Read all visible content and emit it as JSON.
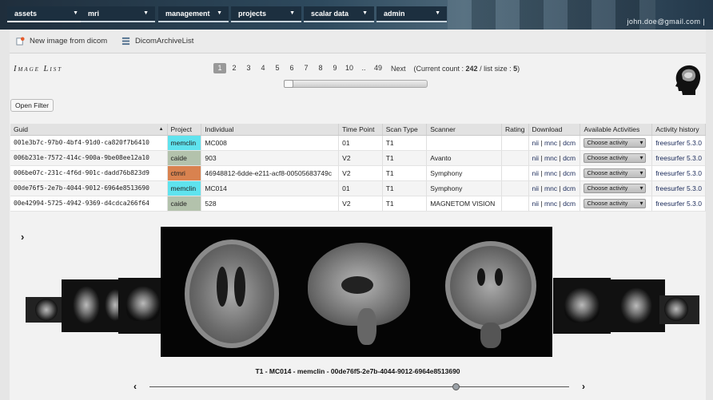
{
  "nav": {
    "menus": [
      {
        "label": "assets",
        "active": true
      },
      {
        "label": "mri"
      },
      {
        "label": "management"
      },
      {
        "label": "projects"
      },
      {
        "label": "scalar data"
      },
      {
        "label": "admin"
      }
    ],
    "user_email": "john.doe@gmail.com |"
  },
  "toolbar": {
    "new_image_label": "New image from dicom",
    "dicom_archive_label": "DicomArchiveList"
  },
  "list": {
    "title": "Image List",
    "open_filter_label": "Open Filter"
  },
  "pager": {
    "pages": [
      "1",
      "2",
      "3",
      "4",
      "5",
      "6",
      "7",
      "8",
      "9",
      "10",
      "..",
      "49"
    ],
    "current": "1",
    "next_label": "Next",
    "count_prefix": "(Current count : ",
    "count_value": "242",
    "count_mid": " / list size : ",
    "size_value": "5",
    "count_suffix": ")"
  },
  "table": {
    "columns": [
      "Guid",
      "Project",
      "Individual",
      "Time Point",
      "Scan Type",
      "Scanner",
      "Rating",
      "Download",
      "Available Activities",
      "Activity history"
    ],
    "rows": [
      {
        "guid": "001e3b7c-97b0-4bf4-91d0-ca820f7b6410",
        "project": "memclin",
        "project_color": "#5fe3ee",
        "individual": "MC008",
        "timepoint": "01",
        "scantype": "T1",
        "scanner": "",
        "rating": "",
        "dl_nii": "nii",
        "dl_mnc": "mnc",
        "dl_dcm": "dcm",
        "activity": "Choose activity",
        "history": "freesurfer 5.3.0"
      },
      {
        "guid": "006b231e-7572-414c-900a-9be08ee12a10",
        "project": "caide",
        "project_color": "#b3c2ac",
        "individual": "903",
        "timepoint": "V2",
        "scantype": "T1",
        "scanner": "Avanto",
        "rating": "",
        "dl_nii": "nii",
        "dl_mnc": "mnc",
        "dl_dcm": "dcm",
        "activity": "Choose activity",
        "history": "freesurfer 5.3.0"
      },
      {
        "guid": "006be07c-231c-4f6d-901c-dadd76b823d9",
        "project": "ctmri",
        "project_color": "#d9824f",
        "individual": "46948812-6dde-e211-acf8-00505683749c",
        "timepoint": "V2",
        "scantype": "T1",
        "scanner": "Symphony",
        "rating": "",
        "dl_nii": "nii",
        "dl_mnc": "mnc",
        "dl_dcm": "dcm",
        "activity": "Choose activity",
        "history": "freesurfer 5.3.0"
      },
      {
        "guid": "00de76f5-2e7b-4044-9012-6964e8513690",
        "project": "memclin",
        "project_color": "#5fe3ee",
        "individual": "MC014",
        "timepoint": "01",
        "scantype": "T1",
        "scanner": "Symphony",
        "rating": "",
        "dl_nii": "nii",
        "dl_mnc": "mnc",
        "dl_dcm": "dcm",
        "activity": "Choose activity",
        "history": "freesurfer 5.3.0"
      },
      {
        "guid": "00e42994-5725-4942-9369-d4cdca266f64",
        "project": "caide",
        "project_color": "#b3c2ac",
        "individual": "528",
        "timepoint": "V2",
        "scantype": "T1",
        "scanner": "MAGNETOM VISION",
        "rating": "",
        "dl_nii": "nii",
        "dl_mnc": "mnc",
        "dl_dcm": "dcm",
        "activity": "Choose activity",
        "history": "freesurfer 5.3.0"
      }
    ],
    "download_sep": "|"
  },
  "viewer": {
    "caption": "T1 - MC014 - memclin - 00de76f5-2e7b-4044-9012-6964e8513690",
    "scrub_position": 0.73
  }
}
